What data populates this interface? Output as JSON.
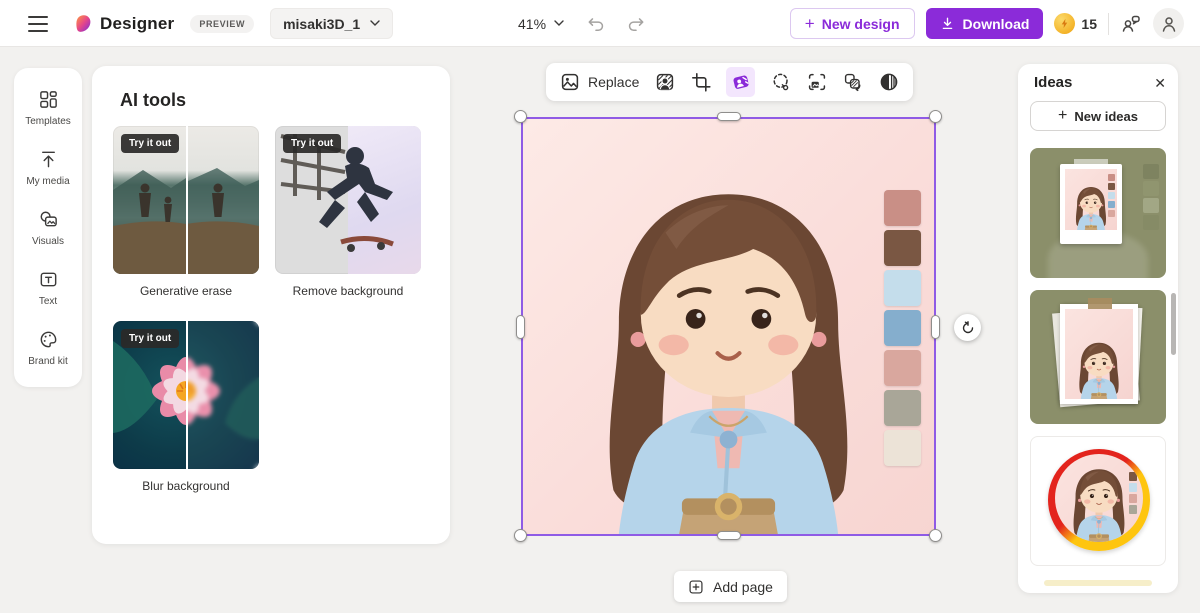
{
  "topbar": {
    "brand": "Designer",
    "preview_badge": "PREVIEW",
    "doc_name": "misaki3D_1",
    "zoom_level": "41%",
    "new_design_label": "New design",
    "download_label": "Download",
    "credits": "15"
  },
  "sidebar": {
    "items": [
      {
        "label": "Templates"
      },
      {
        "label": "My media"
      },
      {
        "label": "Visuals"
      },
      {
        "label": "Text"
      },
      {
        "label": "Brand kit"
      }
    ]
  },
  "ai_tools": {
    "title": "AI tools",
    "badge": "Try it out",
    "cards": [
      {
        "label": "Generative erase"
      },
      {
        "label": "Remove background"
      },
      {
        "label": "Blur background"
      }
    ]
  },
  "canvas_toolbar": {
    "replace_label": "Replace"
  },
  "canvas": {
    "palette": [
      "#c98f86",
      "#7a5743",
      "#c4ddeb",
      "#85aecd",
      "#d9a79e",
      "#a9a698",
      "#ece3d7"
    ]
  },
  "ideas_panel": {
    "title": "Ideas",
    "new_ideas_label": "New ideas",
    "idea1_swatches": [
      "#7e8360",
      "#90956f",
      "#a2a785",
      "#868b66"
    ]
  },
  "add_page_label": "Add page",
  "icons": {
    "plus": "+",
    "close": "✕"
  },
  "colors": {
    "accent_purple": "#8b2bd9",
    "selection_purple": "#8f5be5",
    "idea_olive": "#8b8f6a",
    "canvas_pink": "#fadddа"
  }
}
